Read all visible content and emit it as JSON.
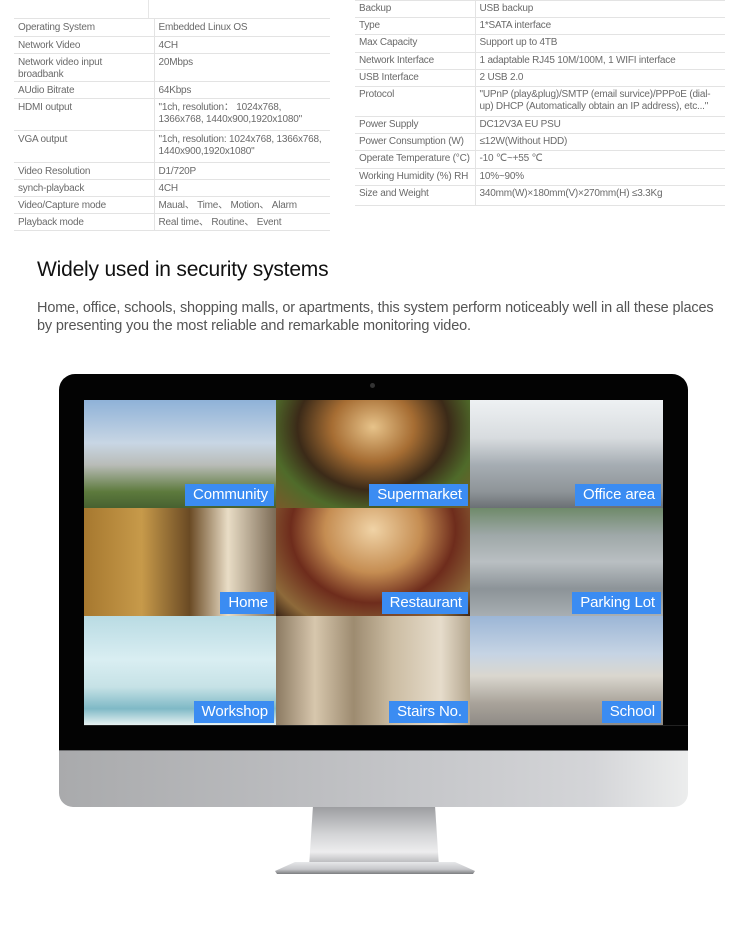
{
  "spec_left": [
    {
      "key": "Operating System",
      "value": "Embedded Linux OS"
    },
    {
      "key": "Network Video",
      "value": "4CH"
    },
    {
      "key": "Network video input broadbank",
      "value": "20Mbps"
    },
    {
      "key": "AUdio Bitrate",
      "value": "64Kbps"
    },
    {
      "key": "HDMI output",
      "value": "\"1ch, resolution： 1024x768, 1366x768, 1440x900,1920x1080\""
    },
    {
      "key": "VGA output",
      "value": "\"1ch, resolution: 1024x768, 1366x768, 1440x900,1920x1080\""
    },
    {
      "key": "Video Resolution",
      "value": "D1/720P"
    },
    {
      "key": "synch-playback",
      "value": "4CH"
    },
    {
      "key": "Video/Capture mode",
      "value": "Maual、 Time、 Motion、 Alarm"
    },
    {
      "key": "Playback mode",
      "value": "Real time、 Routine、 Event"
    }
  ],
  "spec_right": [
    {
      "key": "Backup",
      "value": "USB backup"
    },
    {
      "key": "Type",
      "value": "1*SATA interface"
    },
    {
      "key": "Max Capacity",
      "value": "Support up to 4TB"
    },
    {
      "key": "Network Interface",
      "value": "1 adaptable RJ45 10M/100M, 1 WIFI interface"
    },
    {
      "key": "USB Interface",
      "value": "2 USB 2.0"
    },
    {
      "key": "Protocol",
      "value": "\"UPnP (play&plug)/SMTP (email survice)/PPPoE (dial-up) DHCP (Automatically obtain an IP address), etc...\""
    },
    {
      "key": "Power Supply",
      "value": "DC12V3A EU PSU"
    },
    {
      "key": "Power Consumption (W)",
      "value": "≤12W(Without HDD)"
    },
    {
      "key": "Operate Temperature (°C)",
      "value": "-10 ℃~+55 ℃"
    },
    {
      "key": "Working Humidity (%) RH",
      "value": "10%~90%"
    },
    {
      "key": "Size and Weight",
      "value": "340mm(W)×180mm(V)×270mm(H)  ≤3.3Kg"
    }
  ],
  "section": {
    "title": "Widely used in security systems",
    "description": "Home, office, schools, shopping malls, or apartments, this system perform noticeably well in all these places by presenting you the most reliable and remarkable monitoring video."
  },
  "monitor": {
    "label_color": "#3b8cf2",
    "tiles": [
      {
        "label": "Community",
        "scene": "community"
      },
      {
        "label": "Supermarket",
        "scene": "supermarket"
      },
      {
        "label": "Office area",
        "scene": "office"
      },
      {
        "label": "Home",
        "scene": "home"
      },
      {
        "label": "Restaurant",
        "scene": "restaurant"
      },
      {
        "label": "Parking Lot",
        "scene": "parking"
      },
      {
        "label": "Workshop",
        "scene": "workshop"
      },
      {
        "label": "Stairs No.",
        "scene": "stairs"
      },
      {
        "label": "School",
        "scene": "school"
      }
    ]
  }
}
